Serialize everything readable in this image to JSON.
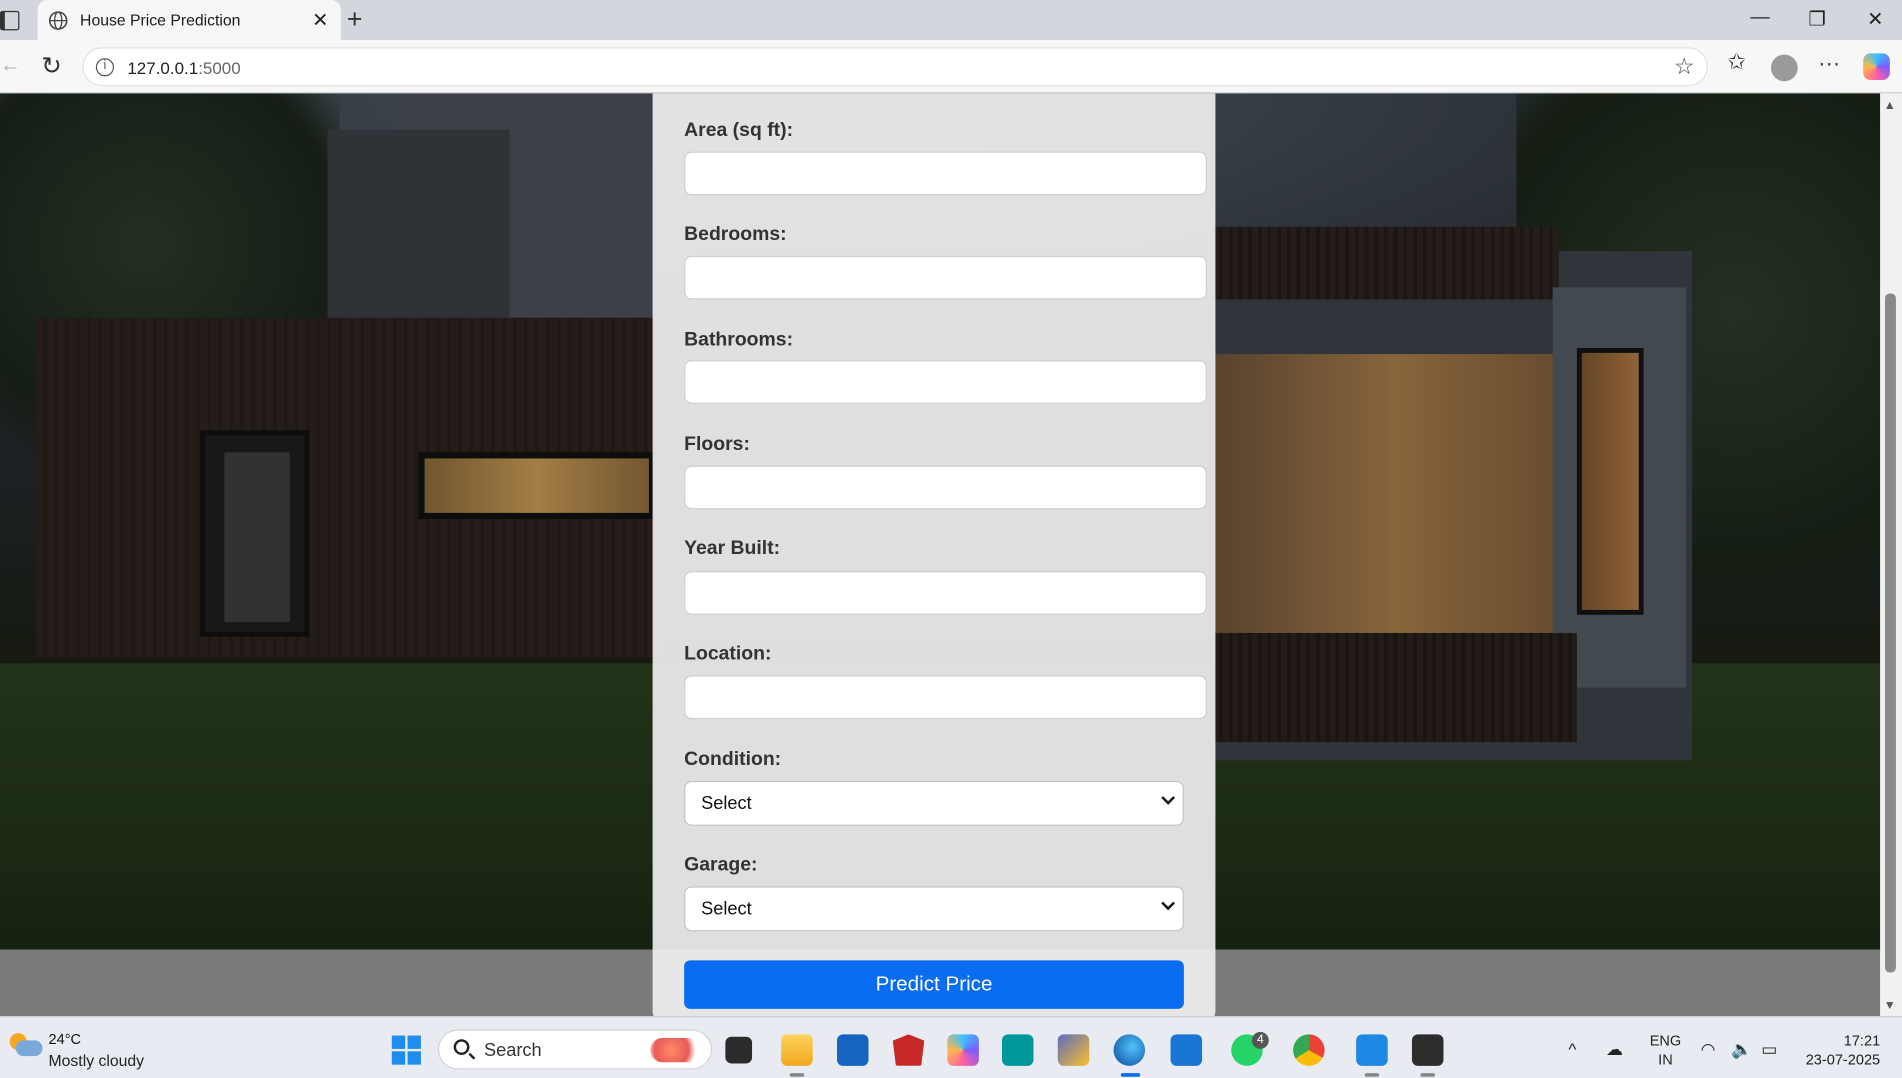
{
  "browser": {
    "tab_title": "House Price Prediction",
    "url_host": "127.0.0.1",
    "url_port": ":5000"
  },
  "form": {
    "fields": [
      {
        "label": "Area (sq ft):",
        "value": ""
      },
      {
        "label": "Bedrooms:",
        "value": ""
      },
      {
        "label": "Bathrooms:",
        "value": ""
      },
      {
        "label": "Floors:",
        "value": ""
      },
      {
        "label": "Year Built:",
        "value": ""
      },
      {
        "label": "Location:",
        "value": ""
      }
    ],
    "condition": {
      "label": "Condition:",
      "selected": "Select"
    },
    "garage": {
      "label": "Garage:",
      "selected": "Select"
    },
    "submit_label": "Predict Price"
  },
  "taskbar": {
    "temperature": "24°C",
    "weather": "Mostly cloudy",
    "search_label": "Search",
    "whatsapp_badge": "4",
    "lang_line1": "ENG",
    "lang_line2": "IN",
    "time": "17:21",
    "date": "23-07-2025"
  },
  "colors": {
    "primary_button": "#0a6cf0",
    "card_background": "#eeeeee"
  }
}
